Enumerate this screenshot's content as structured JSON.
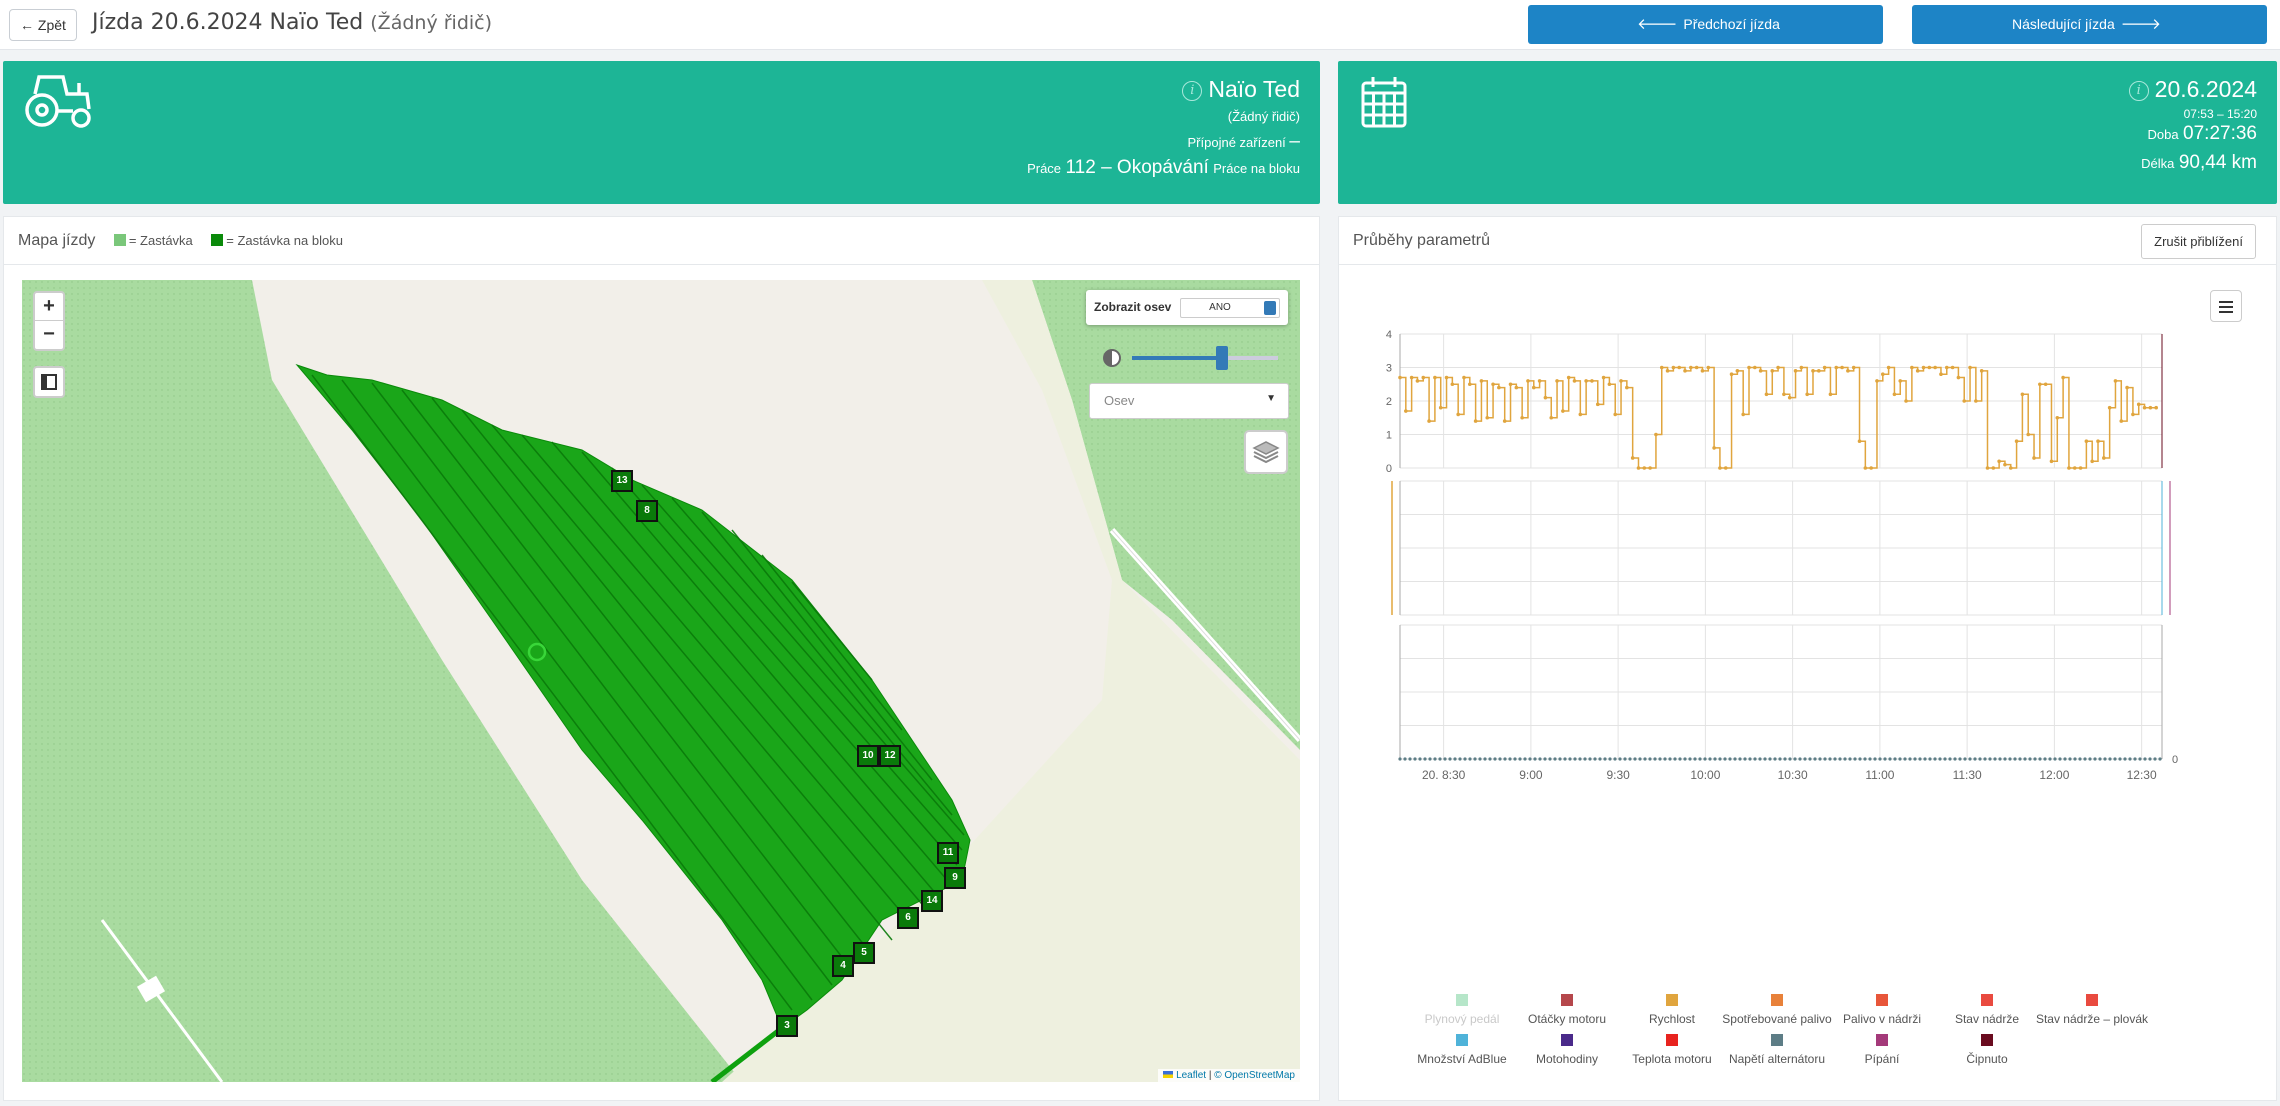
{
  "topbar": {
    "back_label": "Zpět",
    "title": "Jízda 20.6.2024 Naïo Ted",
    "title_sub": "(Žádný řidič)",
    "prev_label": "Předchozí jízda",
    "next_label": "Následující jízda"
  },
  "vehicle_card": {
    "name": "Naïo Ted",
    "driver": "(Žádný řidič)",
    "attachment_label": "Přípojné zařízení",
    "attachment_value": "–",
    "work_label": "Práce",
    "work_value": "112 – Okopávání",
    "work_suffix": "Práce na bloku",
    "icon": "tractor-icon"
  },
  "date_card": {
    "date": "20.6.2024",
    "time_range": "07:53 – 15:20",
    "duration_label": "Doba",
    "duration_value": "07:27:36",
    "length_label": "Délka",
    "length_value": "90,44 km",
    "icon": "calendar-icon"
  },
  "map_panel": {
    "title": "Mapa jízdy",
    "legend": [
      {
        "label": "= Zastávka",
        "color": "#7ac77a"
      },
      {
        "label": "= Zastávka na bloku",
        "color": "#0a8a0a"
      }
    ],
    "zoom_in": "+",
    "zoom_out": "−",
    "show_osev_label": "Zobrazit osev",
    "show_osev_value": "ANO",
    "osev_select_placeholder": "Osev",
    "attribution_leaflet": "Leaflet",
    "attribution_osm": "© OpenStreetMap",
    "stop_markers": [
      "13",
      "8",
      "10",
      "12",
      "11",
      "9",
      "14",
      "6",
      "5",
      "4",
      "3"
    ]
  },
  "chart_panel": {
    "title": "Průběhy parametrů",
    "reset_zoom_label": "Zrušit přiblížení",
    "y_ticks_top": [
      "4",
      "3",
      "2",
      "1",
      "0"
    ],
    "y_tick_bottom_right": "0",
    "x_ticks": [
      "20. 8:30",
      "9:00",
      "9:30",
      "10:00",
      "10:30",
      "11:00",
      "11:30",
      "12:00",
      "12:30"
    ],
    "legend": [
      {
        "label": "Plynový pedál",
        "color": "#b6e6c9",
        "muted": true
      },
      {
        "label": "Otáčky motoru",
        "color": "#b5474b"
      },
      {
        "label": "Rychlost",
        "color": "#e0a53e"
      },
      {
        "label": "Spotřebované palivo",
        "color": "#e8813a"
      },
      {
        "label": "Palivo v nádrži",
        "color": "#e8563a"
      },
      {
        "label": "Stav nádrže",
        "color": "#e94a3f"
      },
      {
        "label": "Stav nádrže – plovák",
        "color": "#e94a3f"
      },
      {
        "label": "Množství AdBlue",
        "color": "#4fb3d9"
      },
      {
        "label": "Motohodiny",
        "color": "#4a2a8a"
      },
      {
        "label": "Teplota motoru",
        "color": "#e8231f"
      },
      {
        "label": "Napětí alternátoru",
        "color": "#5d7d86"
      },
      {
        "label": "Pípání",
        "color": "#a43a7a"
      },
      {
        "label": "Čipnuto",
        "color": "#6a0b1f"
      }
    ]
  },
  "chart_data": {
    "type": "line",
    "x": [
      "8:15",
      "8:17",
      "8:19",
      "8:21",
      "8:23",
      "8:25",
      "8:27",
      "8:29",
      "8:31",
      "8:33",
      "8:35",
      "8:37",
      "8:39",
      "8:41",
      "8:43",
      "8:45",
      "8:47",
      "8:49",
      "8:51",
      "8:53",
      "8:55",
      "8:57",
      "8:59",
      "9:01",
      "9:03",
      "9:05",
      "9:07",
      "9:09",
      "9:11",
      "9:13",
      "9:15",
      "9:17",
      "9:19",
      "9:21",
      "9:23",
      "9:25",
      "9:27",
      "9:29",
      "9:31",
      "9:33",
      "9:35",
      "9:37",
      "9:39",
      "9:41",
      "9:43",
      "9:45",
      "9:47",
      "9:49",
      "9:51",
      "9:53",
      "9:55",
      "9:57",
      "9:59",
      "10:01",
      "10:03",
      "10:05",
      "10:07",
      "10:09",
      "10:11",
      "10:13",
      "10:15",
      "10:17",
      "10:19",
      "10:21",
      "10:23",
      "10:25",
      "10:27",
      "10:29",
      "10:31",
      "10:33",
      "10:35",
      "10:37",
      "10:39",
      "10:41",
      "10:43",
      "10:45",
      "10:47",
      "10:49",
      "10:51",
      "10:53",
      "10:55",
      "10:57",
      "10:59",
      "11:01",
      "11:03",
      "11:05",
      "11:07",
      "11:09",
      "11:11",
      "11:13",
      "11:15",
      "11:17",
      "11:19",
      "11:21",
      "11:23",
      "11:25",
      "11:27",
      "11:29",
      "11:31",
      "11:33",
      "11:35",
      "11:37",
      "11:39",
      "11:41",
      "11:43",
      "11:45",
      "11:47",
      "11:49",
      "11:51",
      "11:53",
      "11:55",
      "11:57",
      "11:59",
      "12:01",
      "12:03",
      "12:05",
      "12:07",
      "12:09",
      "12:11",
      "12:13",
      "12:15",
      "12:17",
      "12:19",
      "12:21",
      "12:23",
      "12:25",
      "12:27",
      "12:29",
      "12:31",
      "12:33",
      "12:35"
    ],
    "series": [
      {
        "name": "Rychlost",
        "values": [
          2.7,
          1.7,
          2.7,
          2.6,
          2.7,
          1.4,
          2.7,
          1.8,
          2.7,
          2.5,
          1.6,
          2.7,
          2.5,
          1.4,
          2.6,
          1.5,
          2.5,
          2.4,
          1.4,
          2.5,
          2.4,
          1.5,
          2.6,
          2.4,
          2.6,
          2.1,
          1.5,
          2.6,
          1.7,
          2.7,
          2.6,
          1.6,
          2.6,
          2.6,
          1.9,
          2.7,
          2.5,
          1.6,
          2.6,
          2.4,
          0.3,
          0.0,
          0.0,
          0.0,
          1.0,
          3.0,
          2.9,
          3.0,
          3.0,
          2.9,
          3.0,
          3.0,
          2.9,
          3.0,
          0.6,
          0.0,
          0.0,
          2.8,
          2.9,
          1.6,
          3.0,
          3.0,
          2.9,
          2.2,
          2.9,
          3.0,
          2.2,
          2.1,
          2.9,
          3.0,
          2.2,
          2.9,
          2.9,
          3.0,
          2.2,
          3.0,
          3.0,
          2.9,
          3.0,
          0.8,
          0.0,
          0.0,
          2.6,
          2.8,
          3.0,
          2.2,
          2.6,
          2.0,
          3.0,
          2.9,
          3.0,
          3.0,
          3.0,
          2.8,
          3.0,
          3.0,
          2.7,
          2.0,
          3.0,
          2.0,
          2.9,
          0.0,
          0.0,
          0.2,
          0.1,
          0.0,
          0.8,
          2.2,
          1.0,
          0.3,
          2.5,
          2.5,
          0.2,
          1.5,
          2.7,
          0.0,
          0.0,
          0.0,
          0.8,
          0.2,
          0.8,
          0.3,
          1.8,
          2.6,
          1.4,
          2.4,
          1.6,
          1.9,
          1.8,
          1.8,
          1.8
        ]
      }
    ],
    "ylim": [
      0,
      4
    ],
    "grid": true,
    "legend_position": "bottom"
  }
}
